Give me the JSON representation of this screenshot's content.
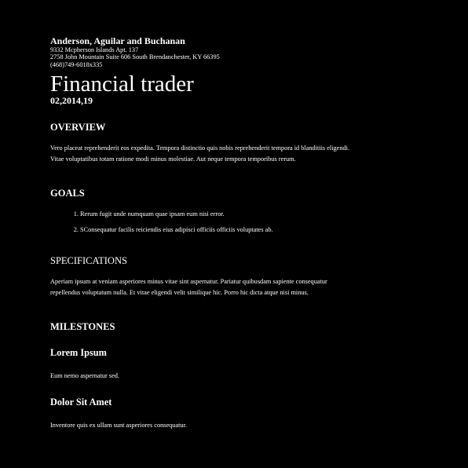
{
  "header": {
    "company": "Anderson, Aguilar and Buchanan",
    "address_lines": [
      "9332 Mcpherson Islands Apt. 137",
      "2758 John Mountain Suite 606 South Brendanchester, KY 66395",
      "(468)749-6018x335"
    ]
  },
  "document": {
    "title": "Financial trader",
    "date": "02,2014,19"
  },
  "sections": {
    "overview": {
      "heading": "OVERVIEW",
      "text": "Vero placeat reprehenderit eos expedita. Tempora distinctio quis nobis reprehenderit tempora id blanditiis eligendi. Vitae voluptatibus totam ratione modi minus molestiae. Aut neque tempora temporibus rerum."
    },
    "goals": {
      "heading": "GOALS",
      "items": [
        "Rerum fugit unde numquam quae ipsam eum nisi error.",
        "SConsequatur facilis reiciendis eius adipisci officiis officiis voluptates ab."
      ]
    },
    "specifications": {
      "heading": "SPECIFICATIONS",
      "text": "Aperiam ipsum at veniam asperiores minus vitae sint aspernatur. Pariatur quibusdam sapiente consequatur repellendus voluptatum nulla. Et vitae eligendi velit similique hic. Porro hic dicta atque nisi minus."
    },
    "milestones": {
      "heading": "MILESTONES",
      "items": [
        {
          "title": "Lorem Ipsum",
          "text": "Eum nemo aspernatur sed."
        },
        {
          "title": "Dolor Sit Amet",
          "text": "Inventore quis ex ullam sunt asperiores consequatur."
        }
      ]
    }
  }
}
